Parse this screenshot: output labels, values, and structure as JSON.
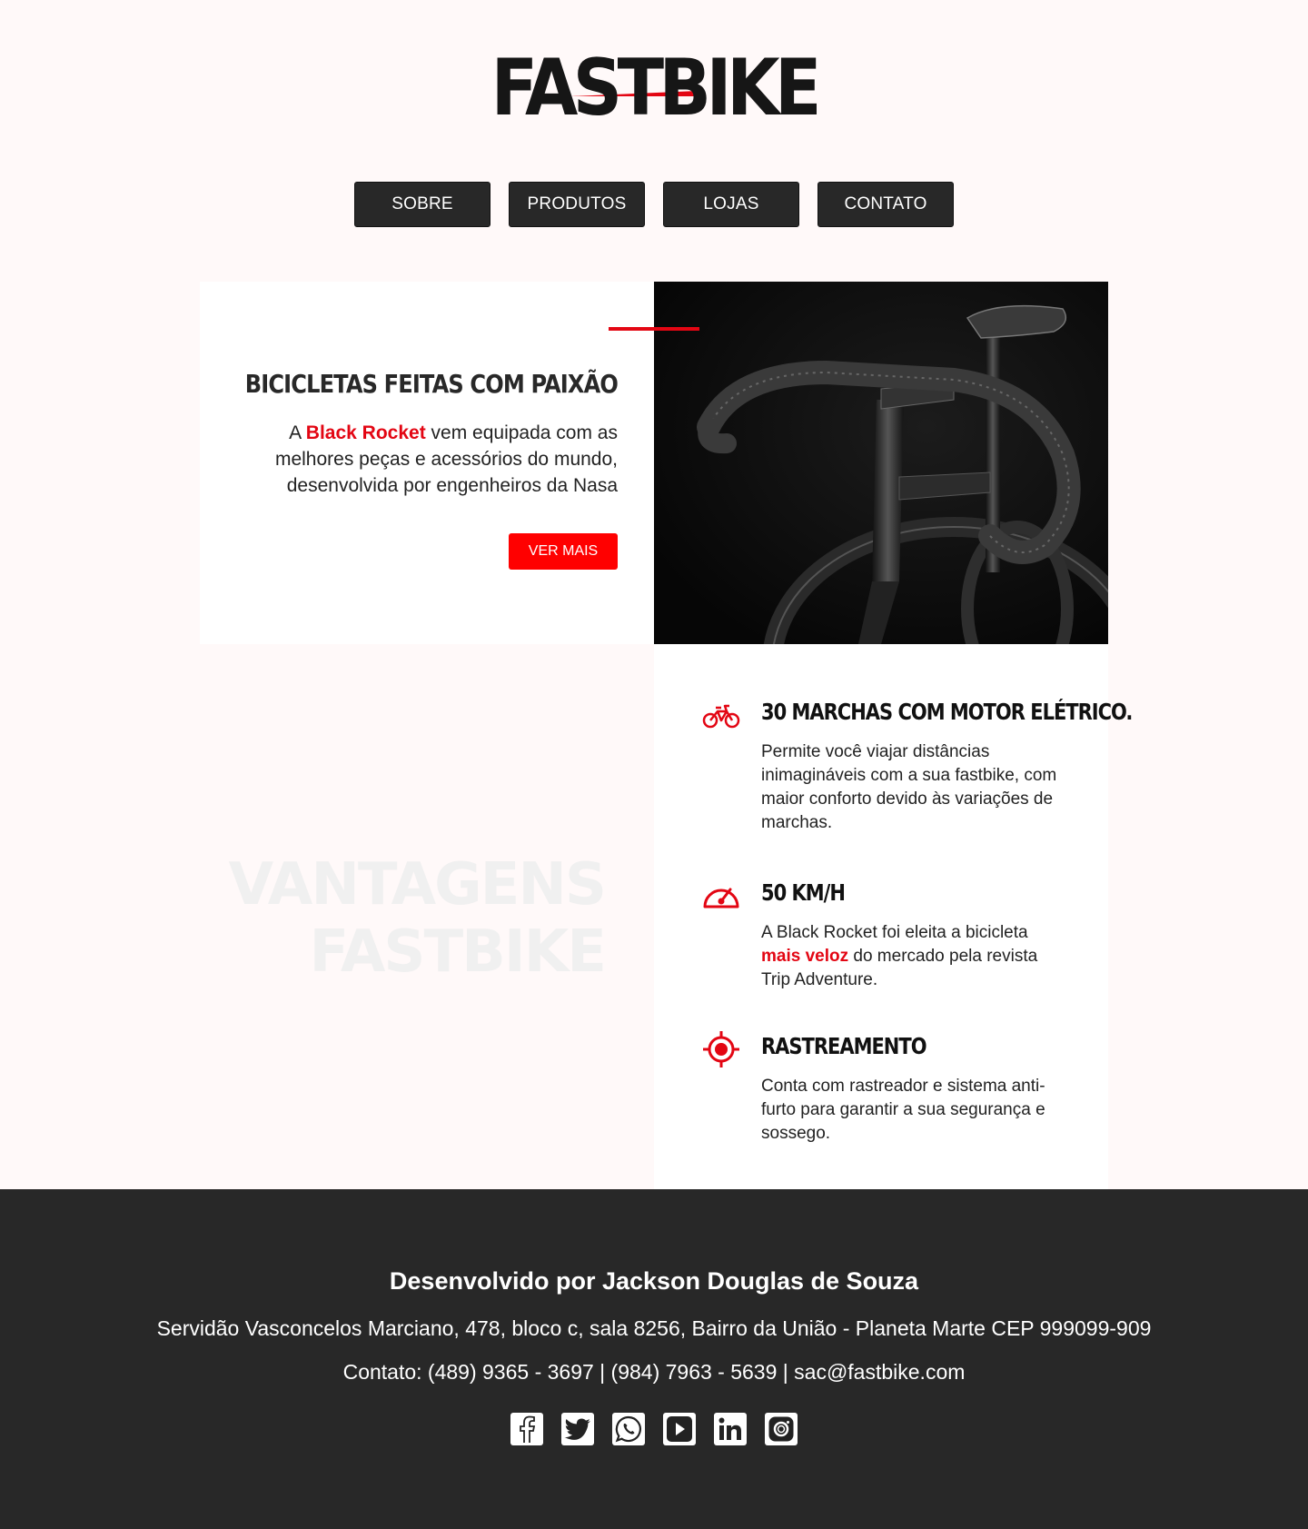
{
  "brand": {
    "logo_text": "FASTBIKE",
    "accent": "#e30613",
    "dark": "#282828"
  },
  "nav": [
    {
      "label": "SOBRE"
    },
    {
      "label": "PRODUTOS"
    },
    {
      "label": "LOJAS"
    },
    {
      "label": "CONTATO"
    }
  ],
  "hero": {
    "title": "BICICLETAS FEITAS COM PAIXÃO",
    "text_prefix": "A ",
    "text_highlight": "Black Rocket",
    "text_suffix": " vem equipada com as melhores peças e acessórios do mundo, desenvolvida por engenheiros da Nasa",
    "button": "VER MAIS"
  },
  "advantages": {
    "heading_line1": "VANTAGENS",
    "heading_line2": "FASTBIKE",
    "features": [
      {
        "icon": "bicycle-icon",
        "title": "30 MARCHAS COM MOTOR ELÉTRICO.",
        "text": "Permite você viajar distâncias inimagináveis com a sua fastbike, com maior conforto devido às variações de marchas."
      },
      {
        "icon": "speedometer-icon",
        "title": "50 KM/H",
        "text_prefix": "A Black Rocket foi eleita a bicicleta ",
        "text_highlight": "mais veloz",
        "text_suffix": " do mercado pela revista Trip Adventure."
      },
      {
        "icon": "target-icon",
        "title": "RASTREAMENTO",
        "text": "Conta com rastreador e sistema anti-furto para garantir a sua segurança e sossego."
      }
    ]
  },
  "footer": {
    "developer": "Desenvolvido por Jackson Douglas de Souza",
    "address": "Servidão Vasconcelos Marciano, 478, bloco c, sala 8256, Bairro da União - Planeta Marte CEP 999099-909",
    "contact": "Contato: (489) 9365 - 3697 | (984) 7963 - 5639 | sac@fastbike.com",
    "socials": [
      "facebook-icon",
      "twitter-icon",
      "whatsapp-icon",
      "youtube-icon",
      "linkedin-icon",
      "instagram-icon"
    ]
  }
}
